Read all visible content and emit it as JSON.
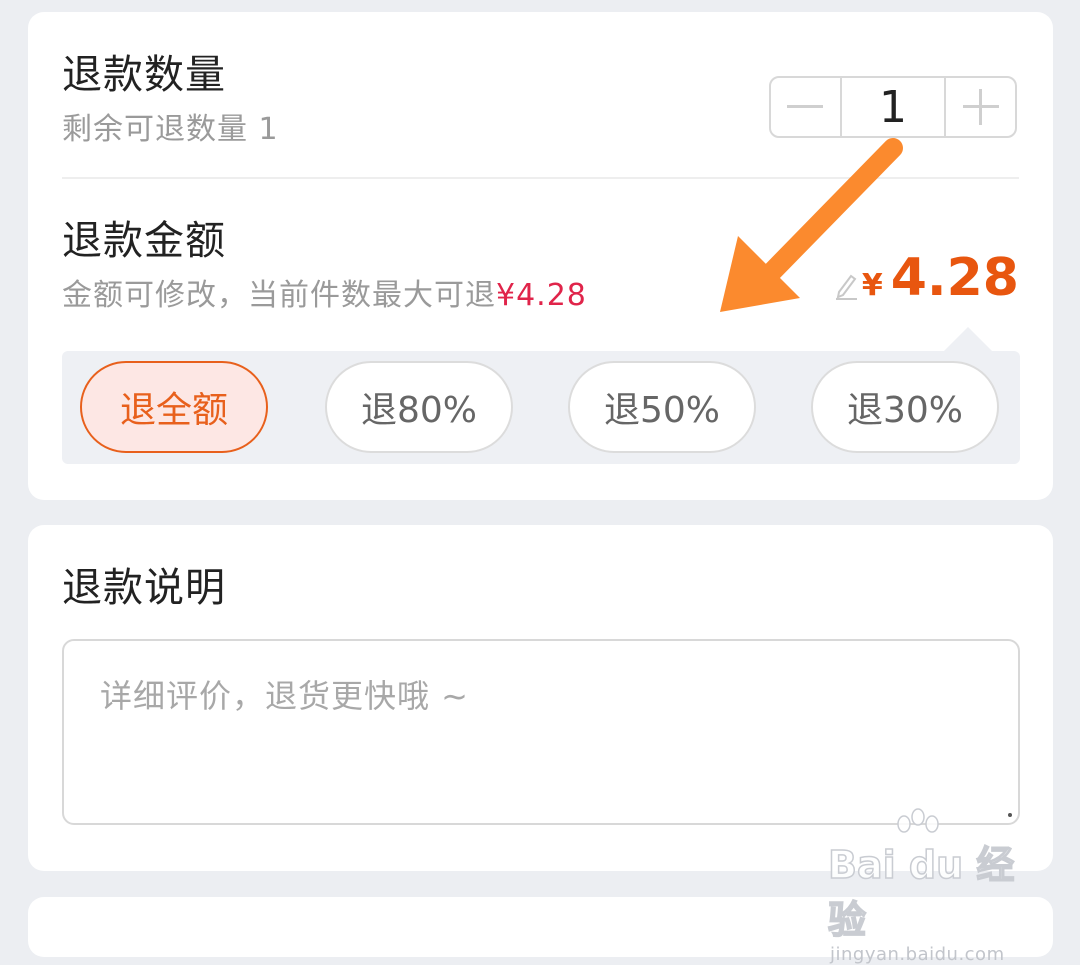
{
  "refund_qty": {
    "title": "退款数量",
    "remaining": "剩余可退数量 1",
    "stepper": {
      "minus": "−",
      "value": "1",
      "plus": "+"
    }
  },
  "refund_amount": {
    "title": "退款金额",
    "hint_prefix": "金额可修改，当前件数最大可退",
    "hint_max": "¥4.28",
    "currency": "¥",
    "value": "4.28",
    "options": [
      {
        "label": "退全额",
        "active": true
      },
      {
        "label": "退80%",
        "active": false
      },
      {
        "label": "退50%",
        "active": false
      },
      {
        "label": "退30%",
        "active": false
      }
    ]
  },
  "refund_note": {
    "title": "退款说明",
    "placeholder": "详细评价，退货更快哦 ~"
  },
  "watermark": {
    "logo": "Bai du 经验",
    "url": "jingyan.baidu.com"
  },
  "colors": {
    "accent": "#e8560f",
    "hint_red": "#e0244a",
    "annotation_arrow": "#fb8a2e"
  },
  "icons": {
    "edit": "pencil-icon",
    "minus": "minus-icon",
    "plus": "plus-icon"
  }
}
